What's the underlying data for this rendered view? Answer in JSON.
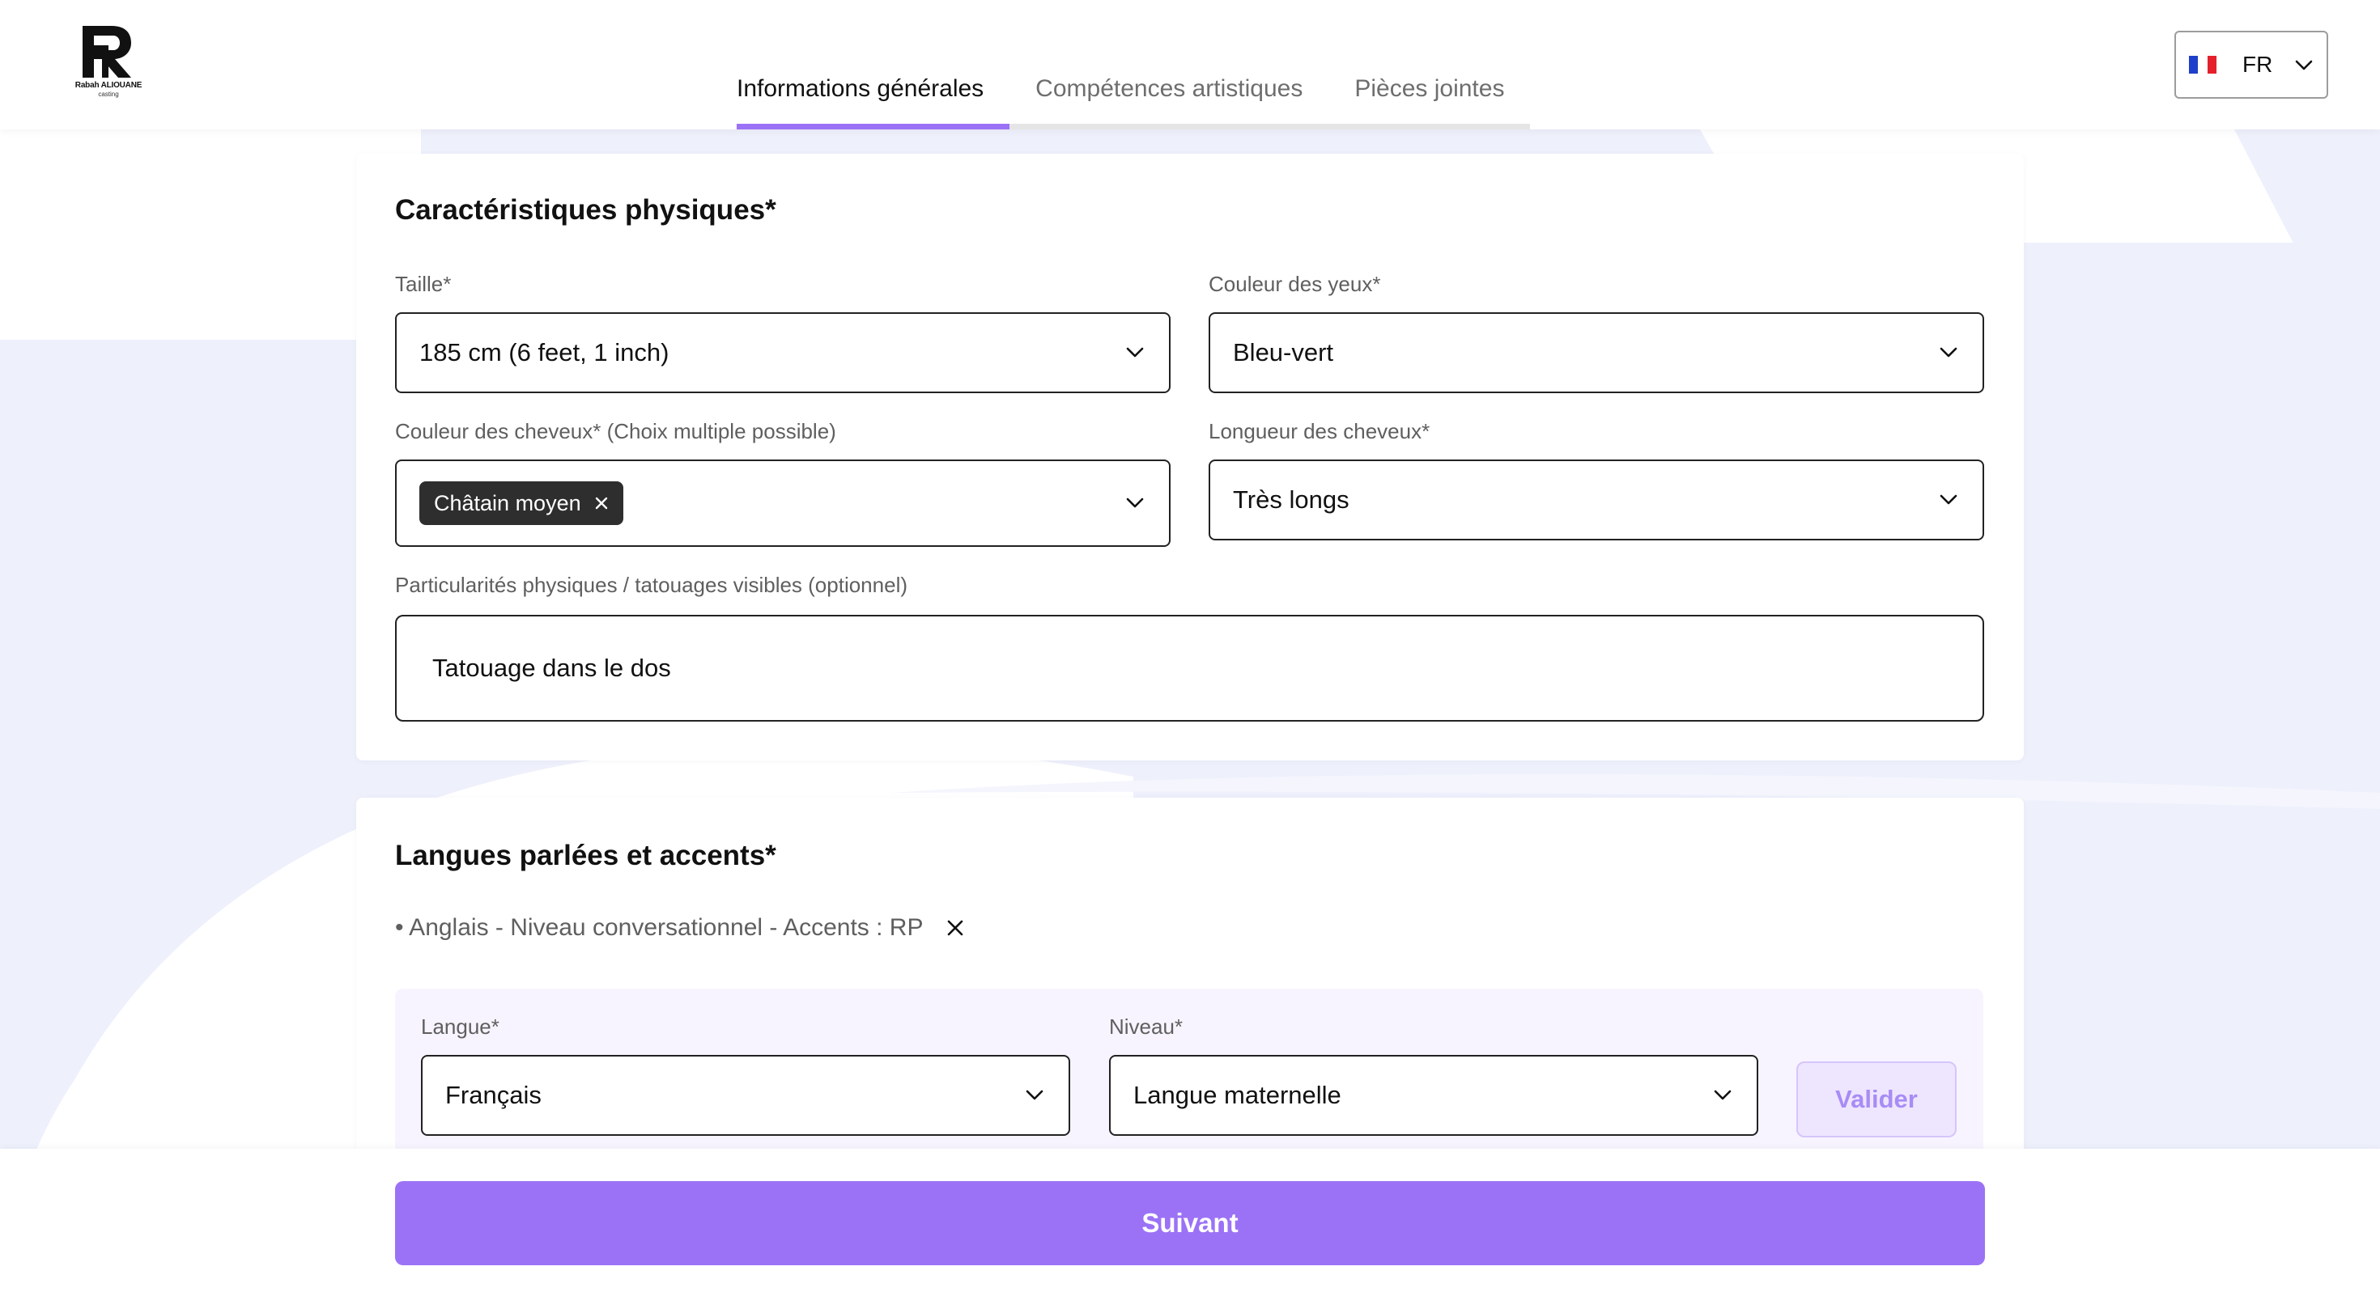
{
  "header": {
    "logo": {
      "name": "Rabah ALIOUANE",
      "subtitle": "casting"
    },
    "tabs": [
      {
        "label": "Informations générales",
        "active": true
      },
      {
        "label": "Compétences artistiques",
        "active": false
      },
      {
        "label": "Pièces jointes",
        "active": false
      }
    ],
    "language": {
      "code": "FR",
      "flag": "france-flag-icon"
    }
  },
  "physical": {
    "title": "Caractéristiques physiques*",
    "height": {
      "label": "Taille*",
      "value": "185 cm (6 feet, 1 inch)"
    },
    "eye_color": {
      "label": "Couleur des yeux*",
      "value": "Bleu-vert"
    },
    "hair_color": {
      "label": "Couleur des cheveux* (Choix multiple possible)",
      "chips": [
        "Châtain moyen"
      ]
    },
    "hair_length": {
      "label": "Longueur des cheveux*",
      "value": "Très longs"
    },
    "features": {
      "label": "Particularités physiques / tatouages visibles (optionnel)",
      "value": "Tatouage dans le dos"
    }
  },
  "languages": {
    "title": "Langues parlées et accents*",
    "entries": [
      "• Anglais - Niveau conversationnel - Accents : RP"
    ],
    "form": {
      "language": {
        "label": "Langue*",
        "value": "Français"
      },
      "level": {
        "label": "Niveau*",
        "value": "Langue maternelle"
      },
      "validate_label": "Valider"
    }
  },
  "footer": {
    "next_label": "Suivant"
  },
  "colors": {
    "accent": "#9b72f6",
    "bg_shape": "#eef0fd",
    "chip": "#2e2e2e"
  }
}
